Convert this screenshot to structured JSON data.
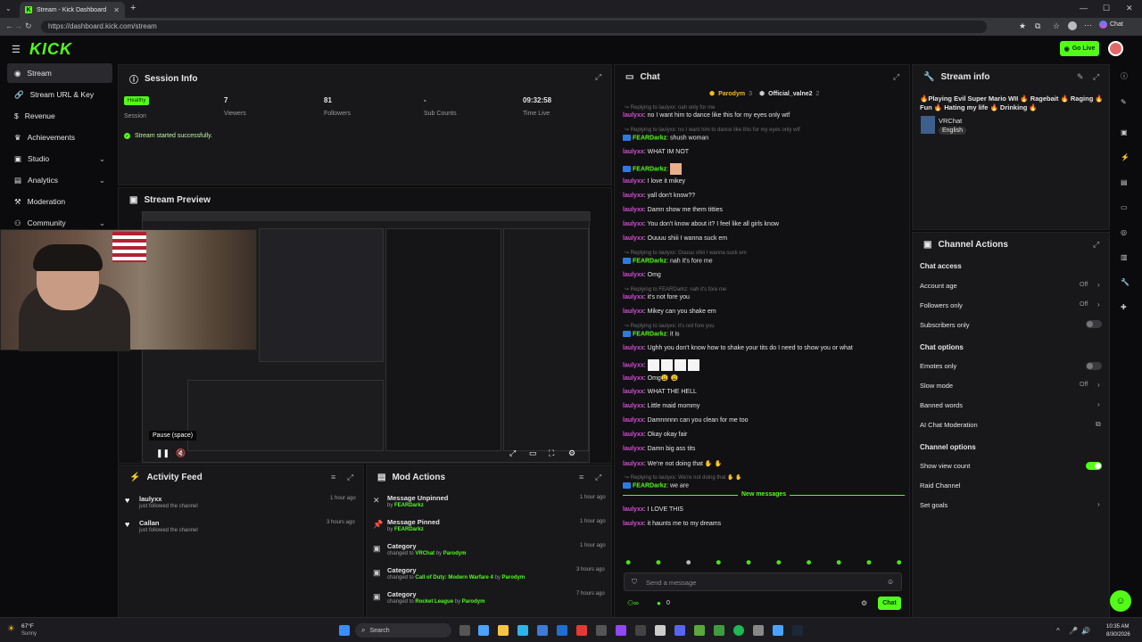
{
  "browser": {
    "tab_title": "Stream - Kick Dashboard",
    "url": "https://dashboard.kick.com/stream",
    "chat_button": "Chat"
  },
  "header": {
    "logo": "KICK",
    "go_live": "Go Live"
  },
  "sidebar": {
    "items": [
      {
        "label": "Stream",
        "icon": "circle-icon"
      },
      {
        "label": "Stream URL & Key",
        "icon": "link-icon"
      },
      {
        "label": "Revenue",
        "icon": "dollar-icon"
      },
      {
        "label": "Achievements",
        "icon": "trophy-icon"
      },
      {
        "label": "Studio",
        "icon": "studio-icon"
      },
      {
        "label": "Analytics",
        "icon": "chart-icon"
      },
      {
        "label": "Moderation",
        "icon": "hammer-icon"
      },
      {
        "label": "Community",
        "icon": "people-icon"
      }
    ]
  },
  "session": {
    "title": "Session Info",
    "session_badge": "Healthy",
    "stats": [
      {
        "value": "",
        "label": "Session"
      },
      {
        "value": "7",
        "label": "Viewers"
      },
      {
        "value": "81",
        "label": "Followers"
      },
      {
        "value": "-",
        "label": "Sub Counts"
      },
      {
        "value": "09:32:58",
        "label": "Time Live"
      }
    ],
    "status_message": "Stream started successfully."
  },
  "preview": {
    "title": "Stream Preview",
    "tooltip": "Pause (space)"
  },
  "activity": {
    "title": "Activity Feed",
    "items": [
      {
        "user": "laulyxx",
        "action": "just followed the channel",
        "time": "1 hour ago"
      },
      {
        "user": "Callan",
        "action": "just followed the channel",
        "time": "3 hours ago"
      }
    ]
  },
  "mod": {
    "title": "Mod Actions",
    "items": [
      {
        "title": "Message Unpinned",
        "prefix": "by",
        "a": "FEARDarkz",
        "mid": "",
        "b": "",
        "time": "1 hour ago"
      },
      {
        "title": "Message Pinned",
        "prefix": "by",
        "a": "FEARDarkz",
        "mid": "",
        "b": "",
        "time": "1 hour ago"
      },
      {
        "title": "Category",
        "prefix": "changed to",
        "a": "VRChat",
        "mid": "by",
        "b": "Parodym",
        "time": "1 hour ago"
      },
      {
        "title": "Category",
        "prefix": "changed to",
        "a": "Call of Duty: Modern Warfare 4",
        "mid": "by",
        "b": "Parodym",
        "time": "3 hours ago"
      },
      {
        "title": "Category",
        "prefix": "changed to",
        "a": "Rocket League",
        "mid": "by",
        "b": "Parodym",
        "time": "7 hours ago"
      }
    ]
  },
  "chat": {
    "title": "Chat",
    "top_user1": "Parodym",
    "top_count1": "3",
    "top_user2": "Official_valne2",
    "top_count2": "2",
    "new_messages": "New messages",
    "placeholder": "Send a message",
    "chat_button": "Chat",
    "viewer_count": "0",
    "messages": [
      {
        "reply": "Replying to laulyxx: nah only for me"
      },
      {
        "user": "laulyxx",
        "text": "no I want him to dance like this for my eyes only wtf"
      },
      {
        "reply": "Replying to laulyxx: no I want him to dance like this for my eyes only wtf"
      },
      {
        "user": "FEARDarkz",
        "text": "shush woman",
        "mod": true
      },
      {
        "user": "laulyxx",
        "text": "WHAT IM NOT"
      },
      {
        "user": "FEARDarkz",
        "text": "",
        "mod": true,
        "emote": true
      },
      {
        "user": "laulyxx",
        "text": "I love it mikey"
      },
      {
        "user": "laulyxx",
        "text": "yall don't know??"
      },
      {
        "user": "laulyxx",
        "text": "Damn show me them titties"
      },
      {
        "user": "laulyxx",
        "text": "You don't know about it? I feel like all girls know"
      },
      {
        "user": "laulyxx",
        "text": "Ouuuu shiii I wanna suck em"
      },
      {
        "reply": "Replying to laulyxx: Ouuuu shiii I wanna suck em"
      },
      {
        "user": "FEARDarkz",
        "text": "nah it's fore me",
        "mod": true
      },
      {
        "user": "laulyxx",
        "text": "Omg"
      },
      {
        "reply": "Replying to FEARDarkz: nah it's fore me"
      },
      {
        "user": "laulyxx",
        "text": "it's not fore you"
      },
      {
        "user": "laulyxx",
        "text": "Mikey can you shake em"
      },
      {
        "reply": "Replying to laulyxx: it's not fore you"
      },
      {
        "user": "FEARDarkz",
        "text": "it is",
        "mod": true
      },
      {
        "user": "laulyxx",
        "text": "Ughh you don't know how to shake your tits do I need to show you or what"
      },
      {
        "user": "laulyxx",
        "text": "",
        "emotes": 4
      },
      {
        "user": "laulyxx",
        "text": "Omg😩 😩"
      },
      {
        "user": "laulyxx",
        "text": "WHAT THE HELL"
      },
      {
        "user": "laulyxx",
        "text": "Little maid mommy"
      },
      {
        "user": "laulyxx",
        "text": "Damnnnnn can you clean for me too"
      },
      {
        "user": "laulyxx",
        "text": "Okay okay fair"
      },
      {
        "user": "laulyxx",
        "text": "Damn big ass tits"
      },
      {
        "user": "laulyxx",
        "text": "We're not doing that ✋ ✋"
      },
      {
        "reply": "Replying to laulyxx: We're not doing that ✋ ✋"
      },
      {
        "user": "FEARDarkz",
        "text": "we are",
        "mod": true
      }
    ],
    "after_new": [
      {
        "user": "laulyxx",
        "text": "I LOVE THIS"
      },
      {
        "user": "laulyxx",
        "text": "it haunts me to my dreams"
      }
    ]
  },
  "stream_info": {
    "title": "Stream info",
    "stream_title": "🔥Playing Evil Super Mario WII 🔥 Ragebait 🔥 Raging 🔥 Fun 🔥 Hating my life 🔥 Drinking 🔥",
    "category": "VRChat",
    "language": "English"
  },
  "channel_actions": {
    "title": "Channel Actions",
    "chat_access": "Chat access",
    "account_age": "Account age",
    "account_age_val": "Off",
    "followers_only": "Followers only",
    "followers_only_val": "Off",
    "subscribers_only": "Subscribers only",
    "chat_options": "Chat options",
    "emotes_only": "Emotes only",
    "slow_mode": "Slow mode",
    "slow_mode_val": "Off",
    "banned_words": "Banned words",
    "ai_moderation": "AI Chat Moderation",
    "channel_options": "Channel options",
    "show_view_count": "Show view count",
    "raid_channel": "Raid Channel",
    "set_goals": "Set goals"
  },
  "taskbar": {
    "weather_temp": "67°F",
    "weather_text": "Sunny",
    "search": "Search",
    "time": "10:35 AM",
    "date": "8/30/2026"
  },
  "colors": {
    "accent": "#53fc18",
    "bg": "#0b0b0d",
    "panel": "#18181b"
  }
}
